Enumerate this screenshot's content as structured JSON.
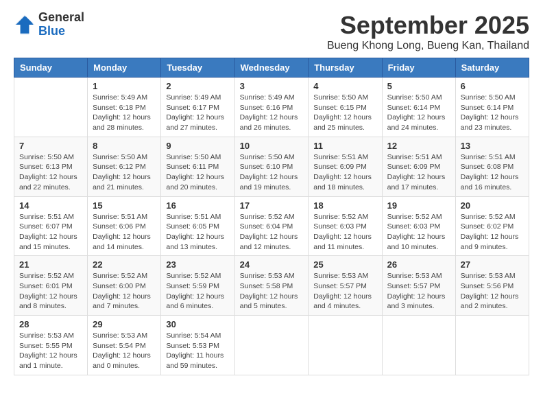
{
  "logo": {
    "general": "General",
    "blue": "Blue"
  },
  "title": "September 2025",
  "location": "Bueng Khong Long, Bueng Kan, Thailand",
  "days_of_week": [
    "Sunday",
    "Monday",
    "Tuesday",
    "Wednesday",
    "Thursday",
    "Friday",
    "Saturday"
  ],
  "weeks": [
    [
      {
        "day": "",
        "info": ""
      },
      {
        "day": "1",
        "info": "Sunrise: 5:49 AM\nSunset: 6:18 PM\nDaylight: 12 hours\nand 28 minutes."
      },
      {
        "day": "2",
        "info": "Sunrise: 5:49 AM\nSunset: 6:17 PM\nDaylight: 12 hours\nand 27 minutes."
      },
      {
        "day": "3",
        "info": "Sunrise: 5:49 AM\nSunset: 6:16 PM\nDaylight: 12 hours\nand 26 minutes."
      },
      {
        "day": "4",
        "info": "Sunrise: 5:50 AM\nSunset: 6:15 PM\nDaylight: 12 hours\nand 25 minutes."
      },
      {
        "day": "5",
        "info": "Sunrise: 5:50 AM\nSunset: 6:14 PM\nDaylight: 12 hours\nand 24 minutes."
      },
      {
        "day": "6",
        "info": "Sunrise: 5:50 AM\nSunset: 6:14 PM\nDaylight: 12 hours\nand 23 minutes."
      }
    ],
    [
      {
        "day": "7",
        "info": "Sunrise: 5:50 AM\nSunset: 6:13 PM\nDaylight: 12 hours\nand 22 minutes."
      },
      {
        "day": "8",
        "info": "Sunrise: 5:50 AM\nSunset: 6:12 PM\nDaylight: 12 hours\nand 21 minutes."
      },
      {
        "day": "9",
        "info": "Sunrise: 5:50 AM\nSunset: 6:11 PM\nDaylight: 12 hours\nand 20 minutes."
      },
      {
        "day": "10",
        "info": "Sunrise: 5:50 AM\nSunset: 6:10 PM\nDaylight: 12 hours\nand 19 minutes."
      },
      {
        "day": "11",
        "info": "Sunrise: 5:51 AM\nSunset: 6:09 PM\nDaylight: 12 hours\nand 18 minutes."
      },
      {
        "day": "12",
        "info": "Sunrise: 5:51 AM\nSunset: 6:09 PM\nDaylight: 12 hours\nand 17 minutes."
      },
      {
        "day": "13",
        "info": "Sunrise: 5:51 AM\nSunset: 6:08 PM\nDaylight: 12 hours\nand 16 minutes."
      }
    ],
    [
      {
        "day": "14",
        "info": "Sunrise: 5:51 AM\nSunset: 6:07 PM\nDaylight: 12 hours\nand 15 minutes."
      },
      {
        "day": "15",
        "info": "Sunrise: 5:51 AM\nSunset: 6:06 PM\nDaylight: 12 hours\nand 14 minutes."
      },
      {
        "day": "16",
        "info": "Sunrise: 5:51 AM\nSunset: 6:05 PM\nDaylight: 12 hours\nand 13 minutes."
      },
      {
        "day": "17",
        "info": "Sunrise: 5:52 AM\nSunset: 6:04 PM\nDaylight: 12 hours\nand 12 minutes."
      },
      {
        "day": "18",
        "info": "Sunrise: 5:52 AM\nSunset: 6:03 PM\nDaylight: 12 hours\nand 11 minutes."
      },
      {
        "day": "19",
        "info": "Sunrise: 5:52 AM\nSunset: 6:03 PM\nDaylight: 12 hours\nand 10 minutes."
      },
      {
        "day": "20",
        "info": "Sunrise: 5:52 AM\nSunset: 6:02 PM\nDaylight: 12 hours\nand 9 minutes."
      }
    ],
    [
      {
        "day": "21",
        "info": "Sunrise: 5:52 AM\nSunset: 6:01 PM\nDaylight: 12 hours\nand 8 minutes."
      },
      {
        "day": "22",
        "info": "Sunrise: 5:52 AM\nSunset: 6:00 PM\nDaylight: 12 hours\nand 7 minutes."
      },
      {
        "day": "23",
        "info": "Sunrise: 5:52 AM\nSunset: 5:59 PM\nDaylight: 12 hours\nand 6 minutes."
      },
      {
        "day": "24",
        "info": "Sunrise: 5:53 AM\nSunset: 5:58 PM\nDaylight: 12 hours\nand 5 minutes."
      },
      {
        "day": "25",
        "info": "Sunrise: 5:53 AM\nSunset: 5:57 PM\nDaylight: 12 hours\nand 4 minutes."
      },
      {
        "day": "26",
        "info": "Sunrise: 5:53 AM\nSunset: 5:57 PM\nDaylight: 12 hours\nand 3 minutes."
      },
      {
        "day": "27",
        "info": "Sunrise: 5:53 AM\nSunset: 5:56 PM\nDaylight: 12 hours\nand 2 minutes."
      }
    ],
    [
      {
        "day": "28",
        "info": "Sunrise: 5:53 AM\nSunset: 5:55 PM\nDaylight: 12 hours\nand 1 minute."
      },
      {
        "day": "29",
        "info": "Sunrise: 5:53 AM\nSunset: 5:54 PM\nDaylight: 12 hours\nand 0 minutes."
      },
      {
        "day": "30",
        "info": "Sunrise: 5:54 AM\nSunset: 5:53 PM\nDaylight: 11 hours\nand 59 minutes."
      },
      {
        "day": "",
        "info": ""
      },
      {
        "day": "",
        "info": ""
      },
      {
        "day": "",
        "info": ""
      },
      {
        "day": "",
        "info": ""
      }
    ]
  ]
}
